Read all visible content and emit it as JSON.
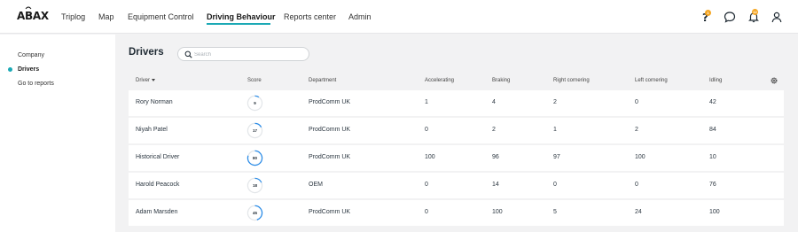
{
  "app": {
    "logo": "ABAX",
    "nav": [
      "Triplog",
      "Map",
      "Equipment Control",
      "Driving Behaviour",
      "Reports center",
      "Admin"
    ],
    "active_nav": "Driving Behaviour",
    "badges": {
      "help": "1",
      "notifications": "12"
    },
    "icons": [
      "help-icon",
      "chat-icon",
      "bell-icon",
      "user-icon"
    ]
  },
  "sidebar": {
    "items": [
      {
        "label": "Company",
        "active": false
      },
      {
        "label": "Drivers",
        "active": true
      },
      {
        "label": "Go to reports",
        "active": false
      }
    ]
  },
  "main": {
    "title": "Drivers",
    "search": {
      "placeholder": "Search",
      "value": ""
    },
    "columns": [
      "Driver",
      "Score",
      "Department",
      "Accelerating",
      "Braking",
      "Right cornering",
      "Left cornering",
      "Idling"
    ],
    "rows": [
      {
        "driver": "Rory Norman",
        "score": 9,
        "department": "ProdComm UK",
        "accelerating": "1",
        "braking": "4",
        "right": "2",
        "left": "0",
        "idling": "42"
      },
      {
        "driver": "Niyah Patel",
        "score": 17,
        "department": "ProdComm UK",
        "accelerating": "0",
        "braking": "2",
        "right": "1",
        "left": "2",
        "idling": "84"
      },
      {
        "driver": "Historical Driver",
        "score": 80,
        "department": "ProdComm UK",
        "accelerating": "100",
        "braking": "96",
        "right": "97",
        "left": "100",
        "idling": "10"
      },
      {
        "driver": "Harold Peacock",
        "score": 18,
        "department": "OEM",
        "accelerating": "0",
        "braking": "14",
        "right": "0",
        "left": "0",
        "idling": "76"
      },
      {
        "driver": "Adam Marsden",
        "score": 45,
        "department": "ProdComm UK",
        "accelerating": "0",
        "braking": "100",
        "right": "5",
        "left": "24",
        "idling": "100"
      }
    ]
  },
  "colors": {
    "accent": "#1ba9b5",
    "score_ring": "#2a8ce8",
    "badge": "#f5a623"
  }
}
